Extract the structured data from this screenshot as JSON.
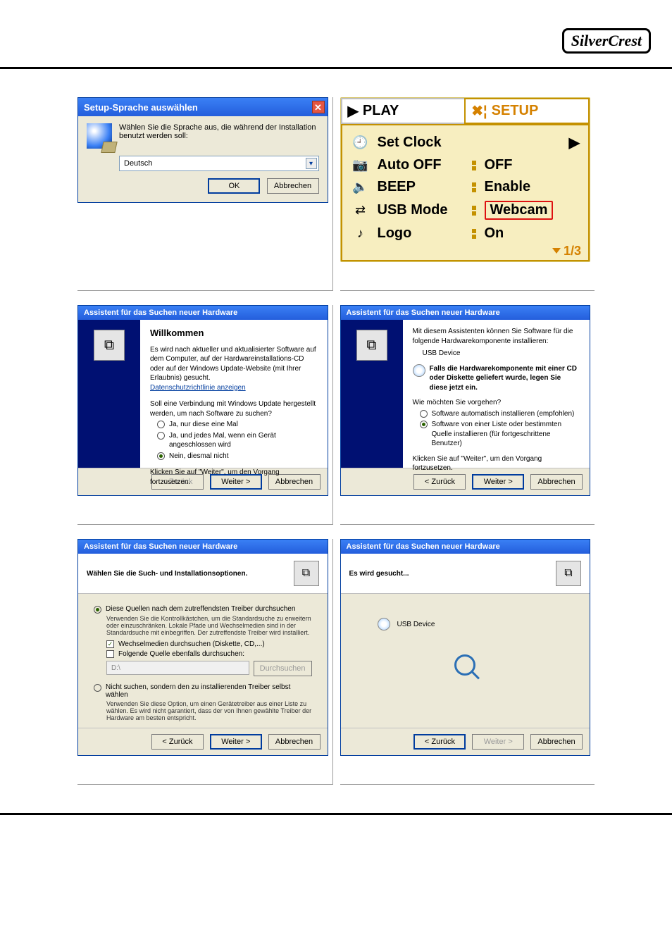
{
  "brand": "SilverCrest",
  "lang_dialog": {
    "title": "Setup-Sprache auswählen",
    "msg": "Wählen Sie die Sprache aus, die während der Installation benutzt werden soll:",
    "selected": "Deutsch",
    "ok": "OK",
    "cancel": "Abbrechen"
  },
  "camera": {
    "tab_play": "PLAY",
    "tab_setup": "SETUP",
    "page": "1/3",
    "items": [
      {
        "icon": "🕘",
        "label": "Set Clock",
        "value": "",
        "arrow": true
      },
      {
        "icon": "📷",
        "label": "Auto OFF",
        "value": "OFF"
      },
      {
        "icon": "🔈",
        "label": "BEEP",
        "value": "Enable"
      },
      {
        "icon": "⇄",
        "label": "USB Mode",
        "value": "Webcam",
        "selected": true
      },
      {
        "icon": "♪",
        "label": "Logo",
        "value": "On"
      }
    ]
  },
  "wizard_title": "Assistent für das Suchen neuer Hardware",
  "wiz1": {
    "heading": "Willkommen",
    "p1": "Es wird nach aktueller und aktualisierter Software auf dem Computer, auf der Hardwareinstallations-CD oder auf der Windows Update-Website (mit Ihrer Erlaubnis) gesucht.",
    "link": "Datenschutzrichtlinie anzeigen",
    "p2": "Soll eine Verbindung mit Windows Update hergestellt werden, um nach Software zu suchen?",
    "opt1": "Ja, nur diese eine Mal",
    "opt2": "Ja, und jedes Mal, wenn ein Gerät angeschlossen wird",
    "opt3": "Nein, diesmal nicht",
    "p3": "Klicken Sie auf \"Weiter\", um den Vorgang fortzusetzen.",
    "back": "< Zurück",
    "next": "Weiter >",
    "cancel": "Abbrechen"
  },
  "wiz2": {
    "p1": "Mit diesem Assistenten können Sie Software für die folgende Hardwarekomponente installieren:",
    "device": "USB Device",
    "cd_note": "Falls die Hardwarekomponente mit einer CD oder Diskette geliefert wurde, legen Sie diese jetzt ein.",
    "p2": "Wie möchten Sie vorgehen?",
    "opt1": "Software automatisch installieren (empfohlen)",
    "opt2": "Software von einer Liste oder bestimmten Quelle installieren (für fortgeschrittene Benutzer)",
    "p3": "Klicken Sie auf \"Weiter\", um den Vorgang fortzusetzen.",
    "back": "< Zurück",
    "next": "Weiter >",
    "cancel": "Abbrechen"
  },
  "wiz3": {
    "heading": "Wählen Sie die Such- und Installationsoptionen.",
    "opt1": "Diese Quellen nach dem zutreffendsten Treiber durchsuchen",
    "opt1_sub": "Verwenden Sie die Kontrollkästchen, um die Standardsuche zu erweitern oder einzuschränken. Lokale Pfade und Wechselmedien sind in der Standardsuche mit einbegriffen. Der zutreffendste Treiber wird installiert.",
    "chk1": "Wechselmedien durchsuchen (Diskette, CD,...)",
    "chk2": "Folgende Quelle ebenfalls durchsuchen:",
    "path": "D:\\",
    "browse": "Durchsuchen",
    "opt2": "Nicht suchen, sondern den zu installierenden Treiber selbst wählen",
    "opt2_sub": "Verwenden Sie diese Option, um einen Gerätetreiber aus einer Liste zu wählen. Es wird nicht garantiert, dass der von Ihnen gewählte Treiber der Hardware am besten entspricht.",
    "back": "< Zurück",
    "next": "Weiter >",
    "cancel": "Abbrechen"
  },
  "wiz4": {
    "heading": "Es wird gesucht...",
    "device": "USB Device",
    "back": "< Zurück",
    "next": "Weiter >",
    "cancel": "Abbrechen"
  }
}
